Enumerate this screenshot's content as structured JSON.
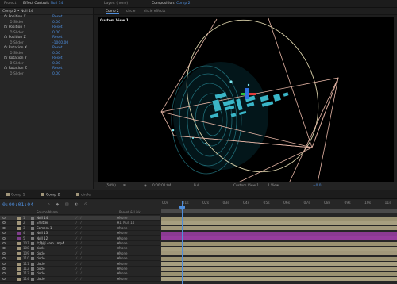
{
  "top_tabs": {
    "project": "Project",
    "effect_controls": "Effect Controls",
    "effect_controls_layer": "Null 14",
    "layer_tab": "Layer: (none)",
    "composition_tab": "Composition:",
    "composition_name": "Comp 2"
  },
  "effect_controls": {
    "header": "Comp 2 • Null 14",
    "rows": [
      {
        "kind": "effect",
        "name": "Position X",
        "value": "Reset"
      },
      {
        "kind": "slider",
        "name": "Slider",
        "value": "0.00"
      },
      {
        "kind": "effect",
        "name": "Position Y",
        "value": "Reset"
      },
      {
        "kind": "slider",
        "name": "Slider",
        "value": "0.00"
      },
      {
        "kind": "effect",
        "name": "Position Z",
        "value": "Reset"
      },
      {
        "kind": "slider",
        "name": "Slider",
        "value": "-1000.00"
      },
      {
        "kind": "effect",
        "name": "Rotation X",
        "value": "Reset"
      },
      {
        "kind": "slider",
        "name": "Slider",
        "value": "0.00"
      },
      {
        "kind": "effect",
        "name": "Rotation Y",
        "value": "Reset"
      },
      {
        "kind": "slider",
        "name": "Slider",
        "value": "0.00"
      },
      {
        "kind": "effect",
        "name": "Rotation Z",
        "value": "Reset"
      },
      {
        "kind": "slider",
        "name": "Slider",
        "value": "0.00"
      }
    ]
  },
  "viewer": {
    "tabs": [
      "Comp 2",
      "circle",
      "circle effects"
    ],
    "canvas_label": "Custom View 1",
    "bottom": {
      "zoom": "(50%)",
      "timecode": "0:00:01:04",
      "resolution": "Full",
      "view": "Custom View 1",
      "views": "1 View",
      "offset": "+0.0"
    }
  },
  "project_tabs": [
    "Comp 1",
    "Comp 2",
    "circle"
  ],
  "timeline": {
    "timecode": "0:00:01:04",
    "columns": {
      "source": "Source Name",
      "parent": "Parent & Link"
    },
    "ruler": [
      "00s",
      "01s",
      "02s",
      "03s",
      "04s",
      "05s",
      "06s",
      "07s",
      "08s",
      "09s",
      "10s",
      "11s"
    ],
    "layers": [
      {
        "num": "1",
        "name": "Null 14",
        "parent": "None",
        "label_color": "#a0957a",
        "bar_color": "#9a9272",
        "selected": true
      },
      {
        "num": "2",
        "name": "Emitter",
        "parent": "1. Null 14",
        "label_color": "#a0957a",
        "bar_color": "#a79f80"
      },
      {
        "num": "3",
        "name": "Camera 1",
        "parent": "None",
        "label_color": "#a0957a",
        "bar_color": "#a1987a"
      },
      {
        "num": "4",
        "name": "Null 13",
        "parent": "None",
        "label_color": "#7f3f8c",
        "bar_color": "#8b3a93"
      },
      {
        "num": "5",
        "name": "Null 12",
        "parent": "None",
        "label_color": "#7f3f8c",
        "bar_color": "#963c9e"
      },
      {
        "num": "107",
        "name": "六角形.com...mp4",
        "parent": "None",
        "label_color": "#a0957a",
        "bar_color": "#9a9272"
      },
      {
        "num": "108",
        "name": "circle",
        "parent": "None",
        "label_color": "#a0957a",
        "bar_color": "#a79f80"
      },
      {
        "num": "109",
        "name": "circle",
        "parent": "None",
        "label_color": "#a0957a",
        "bar_color": "#a1987a"
      },
      {
        "num": "110",
        "name": "circle",
        "parent": "None",
        "label_color": "#a0957a",
        "bar_color": "#9a9272"
      },
      {
        "num": "111",
        "name": "circle",
        "parent": "None",
        "label_color": "#a0957a",
        "bar_color": "#a79f80"
      },
      {
        "num": "112",
        "name": "circle",
        "parent": "None",
        "label_color": "#a0957a",
        "bar_color": "#a1987a"
      },
      {
        "num": "113",
        "name": "circle",
        "parent": "None",
        "label_color": "#a0957a",
        "bar_color": "#9a9272"
      },
      {
        "num": "114",
        "name": "circle",
        "parent": "None",
        "label_color": "#a0957a",
        "bar_color": "#a79f80"
      }
    ]
  },
  "colors": {
    "accent": "#4e8ddb",
    "background": "#232323",
    "camera_frame": "#e4b4a4",
    "particles": "#3ab6c8"
  }
}
